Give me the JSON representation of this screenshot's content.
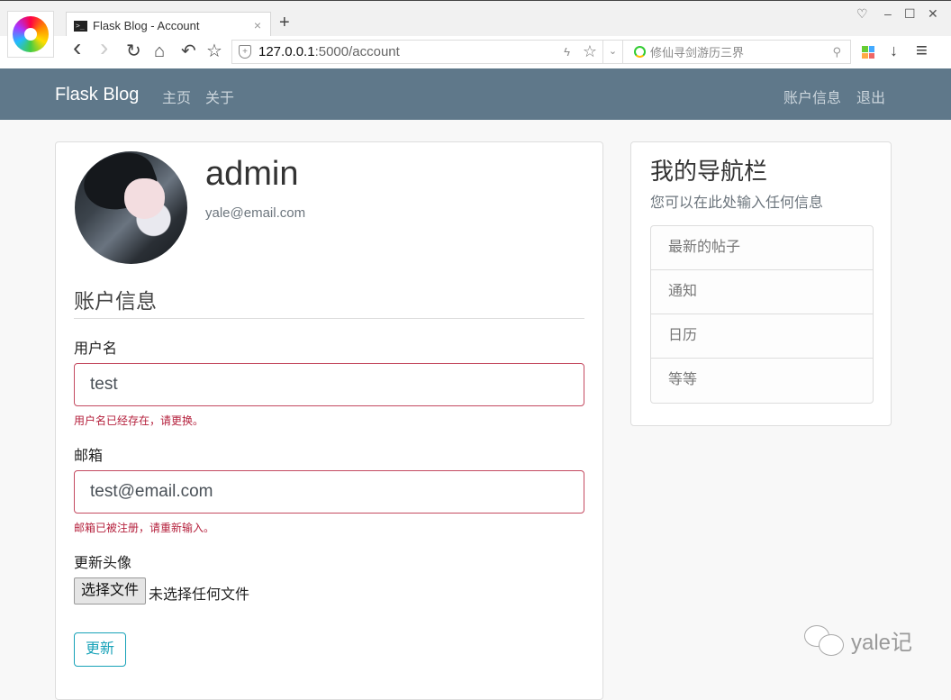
{
  "browser": {
    "tab_title": "Flask Blog - Account",
    "tab_close": "×",
    "new_tab": "+",
    "url_host": "127.0.0.1",
    "url_path": ":5000/account",
    "search_placeholder": "修仙寻剑游历三界",
    "icons": {
      "back": "‹",
      "forward": "›",
      "reload": "↻",
      "home": "⌂",
      "undo": "↶",
      "bookmark": "☆",
      "bolt": "ϟ",
      "star": "☆",
      "dropdown": "⌄",
      "search": "⚲",
      "download": "↓",
      "menu": "≡",
      "skin": "♡",
      "minimize": "–",
      "maximize": "☐",
      "close": "✕"
    }
  },
  "navbar": {
    "brand": "Flask Blog",
    "left_links": [
      "主页",
      "关于"
    ],
    "right_links": [
      "账户信息",
      "退出"
    ]
  },
  "profile": {
    "username": "admin",
    "email": "yale@email.com"
  },
  "form": {
    "legend": "账户信息",
    "username_label": "用户名",
    "username_value": "test",
    "username_error": "用户名已经存在，请更换。",
    "email_label": "邮箱",
    "email_value": "test@email.com",
    "email_error": "邮箱已被注册，请重新输入。",
    "avatar_label": "更新头像",
    "file_button": "选择文件",
    "file_status": "未选择任何文件",
    "submit": "更新"
  },
  "sidebar": {
    "title": "我的导航栏",
    "subtitle": "您可以在此处输入任何信息",
    "items": [
      "最新的帖子",
      "通知",
      "日历",
      "等等"
    ]
  },
  "watermark": {
    "text": "yale记"
  },
  "colors": {
    "navbar": "#5f788a",
    "error": "#b5213d",
    "invalid_border": "#c44a60",
    "submit_accent": "#17a2b8"
  }
}
